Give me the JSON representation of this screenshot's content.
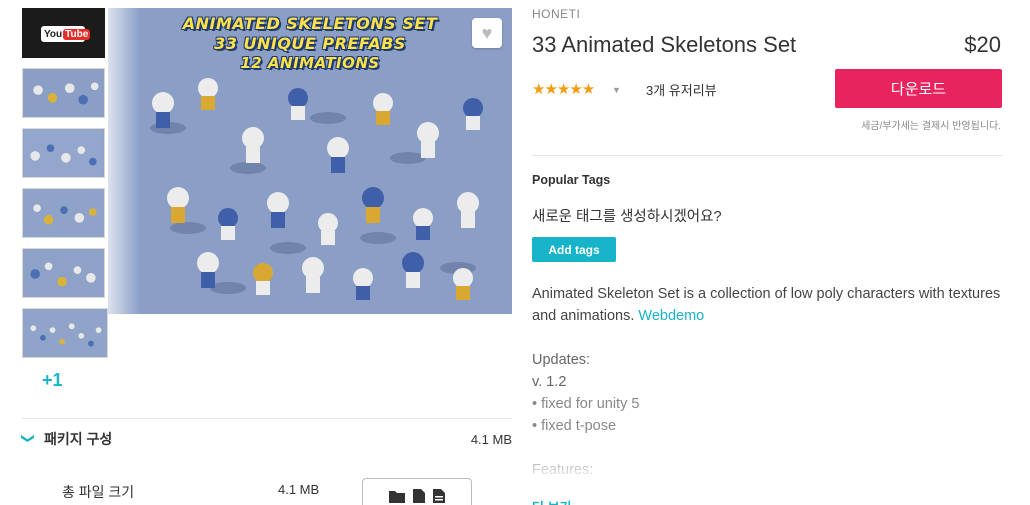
{
  "thumbnails": {
    "video_label_a": "You",
    "video_label_b": "Tube",
    "more_label": "+1"
  },
  "hero": {
    "line1": "ANIMATED SKELETONS SET",
    "line2": "33 UNIQUE PREFABS",
    "line3": "12 ANIMATIONS",
    "heart_icon": "♥"
  },
  "package": {
    "title": "패키지 구성",
    "size": "4.1 MB",
    "total_label": "총 파일 크기",
    "total_size": "4.1 MB",
    "chevron": "❯"
  },
  "product": {
    "publisher": "HONETI",
    "title": "33 Animated Skeletons Set",
    "price": "$20",
    "stars": "★★★★★",
    "stars_caret": "▼",
    "reviews": "3개 유저리뷰",
    "download_label": "다운로드",
    "tax_note": "세금/부가세는 결제시 반영됩니다."
  },
  "tags": {
    "heading": "Popular Tags",
    "prompt": "새로운 태그를 생성하시겠어요?",
    "add_label": "Add tags"
  },
  "description": {
    "text": "Animated Skeleton Set is a collection of low poly characters with textures and animations.",
    "link": "Webdemo"
  },
  "updates": {
    "heading": "Updates:",
    "version": "v. 1.2",
    "items": [
      "• fixed for unity 5",
      "• fixed t-pose"
    ]
  },
  "features": {
    "heading": "Features:",
    "expand_label": "더 보기"
  },
  "colors": {
    "accent": "#17b3c9",
    "download": "#e8245f",
    "star": "#f39c12"
  }
}
